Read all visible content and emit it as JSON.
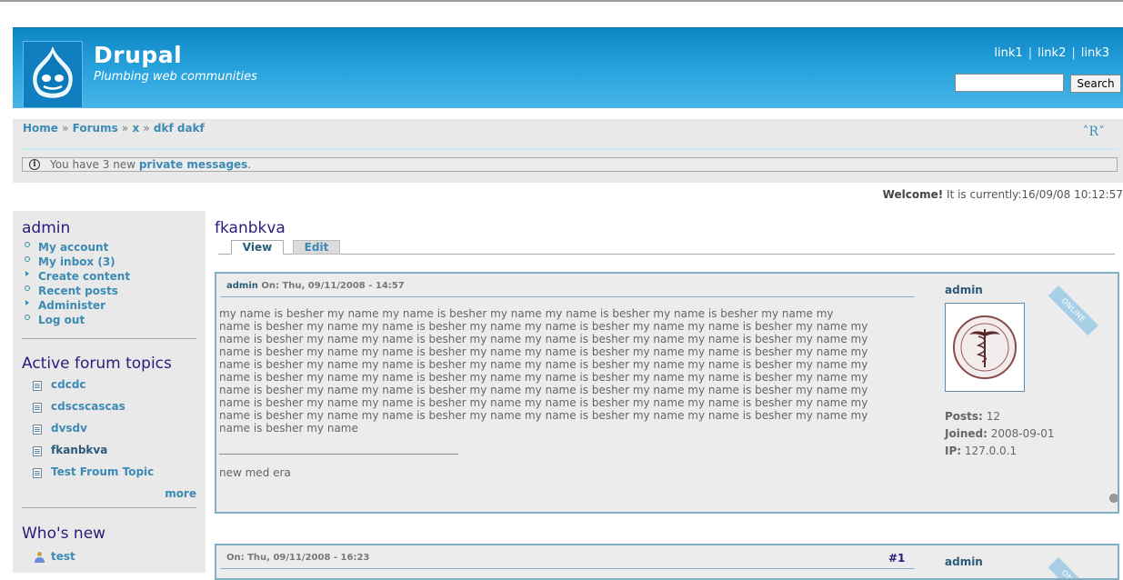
{
  "header": {
    "site_name": "Drupal",
    "slogan": "Plumbing web communities",
    "links": [
      "link1",
      "link2",
      "link3"
    ],
    "search_button": "Search",
    "search_value": ""
  },
  "breadcrumb": {
    "items": [
      "Home",
      "Forums",
      "x",
      "dkf dakf"
    ],
    "separator": "»"
  },
  "text_resize": "R",
  "messages": {
    "prefix": "You have 3 new ",
    "link": "private messages",
    "suffix": "."
  },
  "welcome": {
    "bold": "Welcome!",
    "text": " It is currently:16/09/08 10:12:57"
  },
  "sidebar": {
    "user_title": "admin",
    "user_menu": [
      {
        "label": "My account",
        "bullet": "circle"
      },
      {
        "label": "My inbox (3)",
        "bullet": "circle"
      },
      {
        "label": "Create content",
        "bullet": "triangle"
      },
      {
        "label": "Recent posts",
        "bullet": "circle"
      },
      {
        "label": "Administer",
        "bullet": "triangle"
      },
      {
        "label": "Log out",
        "bullet": "circle"
      }
    ],
    "forum_title": "Active forum topics",
    "forum_topics": [
      "cdcdc",
      "cdscscascas",
      "dvsdv",
      "fkanbkva",
      "Test Froum Topic"
    ],
    "more": "more",
    "whos_new_title": "Who's new",
    "whos_new_user": "test"
  },
  "node": {
    "title": "fkanbkva",
    "tabs": [
      "View",
      "Edit"
    ]
  },
  "posts": [
    {
      "author_link": "admin",
      "meta": " On: Thu, 09/11/2008 - 14:57",
      "number": "",
      "body_lines": [
        "my name is besher my name my name is besher my name my name is besher my name is besher my name my",
        "name is besher my name my name is besher my name my name is besher my name my name is besher my name my",
        "name is besher my name my name is besher my name my name is besher my name my name is besher my name my",
        "name is besher my name my name is besher my name my name is besher my name my name is besher my name my",
        "name is besher my name my name is besher my name my name is besher my name my name is besher my name my",
        "name is besher my name my name is besher my name my name is besher my name my name is besher my name my",
        "name is besher my name my name is besher my name my name is besher my name my name is besher my name my",
        "name is besher my name my name is besher my name my name is besher my name my name is besher my name my",
        "name is besher my name my name is besher my name my name is besher my name my name is besher my name my",
        "name is besher my name"
      ],
      "signature": "new med era",
      "author": "admin",
      "online": "ONLINE",
      "posts_label": "Posts:",
      "posts_value": "12",
      "joined_label": "Joined:",
      "joined_value": "2008-09-01",
      "ip_label": "IP:",
      "ip_value": "127.0.0.1"
    },
    {
      "author_link": "",
      "meta": "On: Thu, 09/11/2008 - 16:23",
      "number": "#1",
      "author": "admin",
      "online": "ONLINE"
    }
  ],
  "colors": {
    "header_blue": "#1a96d2",
    "link": "#3b8bb4",
    "title_purple": "#2a1b7a",
    "post_border": "#7fb0c4"
  }
}
